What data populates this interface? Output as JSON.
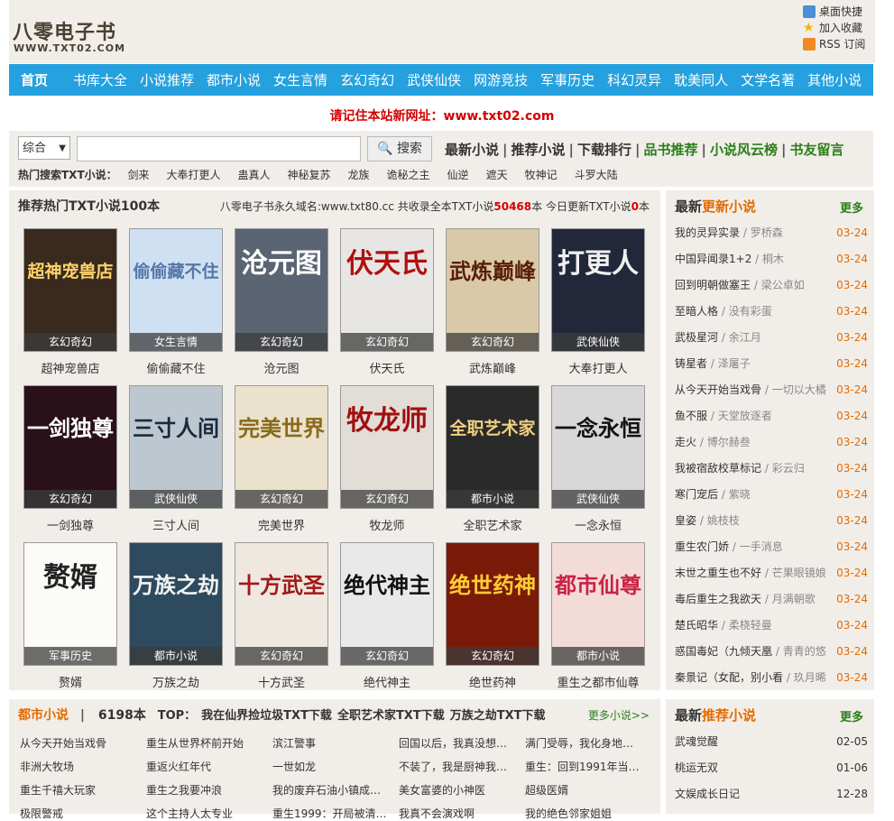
{
  "header": {
    "logo_cn": "八零电子书",
    "logo_en": "WWW.TXT02.COM",
    "tools": [
      "桌面快捷",
      "加入收藏",
      "RSS 订阅"
    ]
  },
  "nav": [
    "首页",
    "书库大全",
    "小说推荐",
    "都市小说",
    "女生言情",
    "玄幻奇幻",
    "武侠仙侠",
    "网游竞技",
    "军事历史",
    "科幻灵异",
    "耽美同人",
    "文学名著",
    "其他小说"
  ],
  "notice": "请记住本站新网址：www.txt02.com",
  "search": {
    "select_value": "综合",
    "button_label": "搜索",
    "quick_links": [
      "最新小说",
      "推荐小说",
      "下载排行",
      "品书推荐",
      "小说风云榜",
      "书友留言"
    ],
    "hot_label": "热门搜索TXT小说：",
    "hot": [
      "剑来",
      "大奉打更人",
      "蛊真人",
      "神秘复苏",
      "龙族",
      "诡秘之主",
      "仙逆",
      "遮天",
      "牧神记",
      "斗罗大陆"
    ]
  },
  "recommend": {
    "title": "推荐热门TXT小说100本",
    "info_pre": "八零电子书永久域名:www.txt80.cc 共收录全本TXT小说",
    "total": "50468",
    "info_mid": "本 今日更新TXT小说",
    "today": "0",
    "info_post": "本",
    "books": [
      {
        "name": "超神宠兽店",
        "tag": "玄幻奇幻",
        "cover_text": "超神宠兽店",
        "bg": "#3a2a1e",
        "fg": "#ffd36a"
      },
      {
        "name": "偷偷藏不住",
        "tag": "女生言情",
        "cover_text": "偷偷藏不住",
        "bg": "#cfe0f2",
        "fg": "#5577aa"
      },
      {
        "name": "沧元图",
        "tag": "玄幻奇幻",
        "cover_text": "沧元图",
        "bg": "#5b6472",
        "fg": "#ffffff"
      },
      {
        "name": "伏天氏",
        "tag": "玄幻奇幻",
        "cover_text": "伏天氏",
        "bg": "#e8e6e4",
        "fg": "#b01010"
      },
      {
        "name": "武炼巅峰",
        "tag": "玄幻奇幻",
        "cover_text": "武炼巅峰",
        "bg": "#d9c9a8",
        "fg": "#5a1e08"
      },
      {
        "name": "大奉打更人",
        "tag": "武侠仙侠",
        "cover_text": "打更人",
        "bg": "#22283a",
        "fg": "#f0f0f0"
      },
      {
        "name": "一剑独尊",
        "tag": "玄幻奇幻",
        "cover_text": "一剑独尊",
        "bg": "#2a1018",
        "fg": "#ffffff"
      },
      {
        "name": "三寸人间",
        "tag": "武侠仙侠",
        "cover_text": "三寸人间",
        "bg": "#bcc7cf",
        "fg": "#1a2a3a"
      },
      {
        "name": "完美世界",
        "tag": "玄幻奇幻",
        "cover_text": "完美世界",
        "bg": "#eae2cc",
        "fg": "#8a6a1a"
      },
      {
        "name": "牧龙师",
        "tag": "玄幻奇幻",
        "cover_text": "牧龙师",
        "bg": "#e2ddd6",
        "fg": "#a01010"
      },
      {
        "name": "全职艺术家",
        "tag": "都市小说",
        "cover_text": "全职艺术家",
        "bg": "#2a2a2a",
        "fg": "#f0d080"
      },
      {
        "name": "一念永恒",
        "tag": "武侠仙侠",
        "cover_text": "一念永恒",
        "bg": "#d8d8d8",
        "fg": "#111111"
      },
      {
        "name": "赘婿",
        "tag": "军事历史",
        "cover_text": "赘婿",
        "bg": "#fbfbf8",
        "fg": "#222222"
      },
      {
        "name": "万族之劫",
        "tag": "都市小说",
        "cover_text": "万族之劫",
        "bg": "#2e4a5e",
        "fg": "#f2f2f2"
      },
      {
        "name": "十方武圣",
        "tag": "玄幻奇幻",
        "cover_text": "十方武圣",
        "bg": "#efe8e0",
        "fg": "#a01818"
      },
      {
        "name": "绝代神主",
        "tag": "玄幻奇幻",
        "cover_text": "绝代神主",
        "bg": "#e9e9e9",
        "fg": "#111111"
      },
      {
        "name": "绝世药神",
        "tag": "玄幻奇幻",
        "cover_text": "绝世药神",
        "bg": "#7a1a08",
        "fg": "#ffcc33"
      },
      {
        "name": "重生之都市仙尊",
        "tag": "都市小说",
        "cover_text": "都市仙尊",
        "bg": "#f3dcd8",
        "fg": "#cc2244"
      }
    ]
  },
  "latest": {
    "title_a": "最新",
    "title_b": "更新小说",
    "more": "更多",
    "items": [
      {
        "name": "我的灵异实录",
        "author": "罗桥森",
        "date": "03-24"
      },
      {
        "name": "中国异闻录1+2",
        "author": "桐木",
        "date": "03-24"
      },
      {
        "name": "回到明朝做塞王",
        "author": "梁公卓如",
        "date": "03-24"
      },
      {
        "name": "至暗人格",
        "author": "没有彩蛋",
        "date": "03-24"
      },
      {
        "name": "武极星河",
        "author": "余江月",
        "date": "03-24"
      },
      {
        "name": "铸星者",
        "author": "泽屠子",
        "date": "03-24"
      },
      {
        "name": "从今天开始当戏骨",
        "author": "一切以大橘",
        "date": "03-24"
      },
      {
        "name": "鱼不服",
        "author": "天堂放逐者",
        "date": "03-24"
      },
      {
        "name": "走火",
        "author": "博尔赫叁",
        "date": "03-24"
      },
      {
        "name": "我被宿敌校草标记",
        "author": "彩云归",
        "date": "03-24"
      },
      {
        "name": "寒门宠后",
        "author": "紫晓",
        "date": "03-24"
      },
      {
        "name": "皇姿",
        "author": "姚枝枝",
        "date": "03-24"
      },
      {
        "name": "重生农门娇",
        "author": "一手消息",
        "date": "03-24"
      },
      {
        "name": "末世之重生也不好",
        "author": "芒果眼镜娘",
        "date": "03-24"
      },
      {
        "name": "毒后重生之我欲天",
        "author": "月满朝歌",
        "date": "03-24"
      },
      {
        "name": "楚氏昭华",
        "author": "柔桡轻曼",
        "date": "03-24"
      },
      {
        "name": "惑国毒妃（九倾天凰",
        "author": "青青的悠",
        "date": "03-24"
      },
      {
        "name": "秦景记（女配，别小看",
        "author": "玖月晞",
        "date": "03-24"
      }
    ]
  },
  "latest_rec": {
    "title_a": "最新",
    "title_b": "推荐小说",
    "more": "更多",
    "items": [
      {
        "name": "武魂觉醒",
        "date": "02-05"
      },
      {
        "name": "桃运无双",
        "date": "01-06"
      },
      {
        "name": "文娱成长日记",
        "date": "12-28"
      }
    ]
  },
  "urban": {
    "title": "都市小说",
    "count": "6198本",
    "top_label": "TOP：",
    "tops": [
      "我在仙界捡垃圾TXT下载",
      "全职艺术家TXT下载",
      "万族之劫TXT下载"
    ],
    "more": "更多小说>>",
    "rows": [
      [
        "从今天开始当戏骨",
        "重生从世界杯前开始",
        "滨江警事",
        "回国以后，我真没想…",
        "满门受辱，我化身地…"
      ],
      [
        "非洲大牧场",
        "重返火红年代",
        "一世如龙",
        "不装了，我是厨神我…",
        "重生：回到1991年当…"
      ],
      [
        "重生千禧大玩家",
        "重生之我要冲浪",
        "我的废弃石油小镇成…",
        "美女富婆的小神医",
        "超级医婿"
      ],
      [
        "极限警戒",
        "这个主持人太专业",
        "重生1999：开局被清…",
        "我真不会演戏啊",
        "我的绝色邻家姐姐"
      ]
    ]
  }
}
